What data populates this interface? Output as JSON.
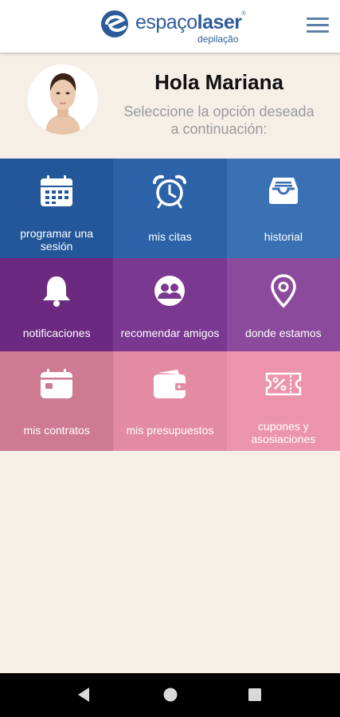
{
  "brand": {
    "name_light": "espaço",
    "name_bold": "laser",
    "registered": "®",
    "tagline": "depilação",
    "color": "#2d5b9a"
  },
  "header": {
    "greeting": "Hola Mariana",
    "subtitle_line1": "Seleccione la opción deseada",
    "subtitle_line2": "a continuación:"
  },
  "tiles": [
    {
      "label": "programar una sesión",
      "icon": "calendar-icon",
      "color": "#23579a"
    },
    {
      "label": "mis citas",
      "icon": "alarm-clock-icon",
      "color": "#2c63a8"
    },
    {
      "label": "historial",
      "icon": "inbox-tray-icon",
      "color": "#3a71b4"
    },
    {
      "label": "notificaciones",
      "icon": "bell-icon",
      "color": "#6b2a80"
    },
    {
      "label": "recomendar amigos",
      "icon": "friends-icon",
      "color": "#7a3890"
    },
    {
      "label": "donde estamos",
      "icon": "location-pin-icon",
      "color": "#8b4a9b"
    },
    {
      "label": "mis contratos",
      "icon": "calendar-card-icon",
      "color": "#cd7a92"
    },
    {
      "label": "mis presupuestos",
      "icon": "wallet-icon",
      "color": "#e38ba3"
    },
    {
      "label": "cupones y asosiaciones",
      "icon": "coupon-icon",
      "color": "#ec94ab"
    }
  ],
  "tile_label_lines": {
    "t0a": "programar una",
    "t0b": "sesión",
    "t8a": "cupones y",
    "t8b": "asosiaciones"
  },
  "colors": {
    "background": "#f6efe8",
    "topbar": "#ffffff",
    "menu_icon": "#5e7fa7"
  }
}
